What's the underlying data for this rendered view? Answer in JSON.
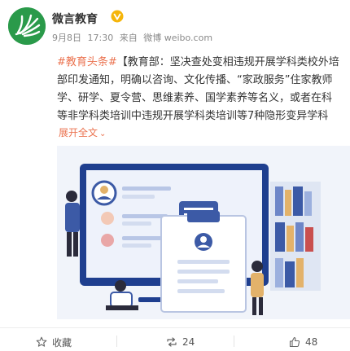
{
  "account": {
    "name": "微言教育",
    "verified_badge": "V"
  },
  "meta": {
    "date": "9月8日",
    "time": "17:30",
    "source_prefix": "来自",
    "source": "微博 weibo.com"
  },
  "post": {
    "hashtag": "#教育头条#",
    "lines": [
      "【教育部：坚决查处变相违规开展学科类校外培",
      "部印发通知，明确以咨询、文化传播、“家政服务”住家教师",
      "学、研学、夏令营、思维素养、国学素养等名义，或者在科",
      "等非学科类培训中违规开展学科类培训等7种隐形变异学科"
    ],
    "expand_label": "展开全文",
    "expand_icon": "chevron-down-icon"
  },
  "actions": {
    "favorite_label": "收藏",
    "repost_count": "24",
    "like_count": "48"
  },
  "colors": {
    "accent": "#eb7350",
    "brand_green": "#2a9a4a",
    "badge_yellow": "#f5b50a"
  }
}
